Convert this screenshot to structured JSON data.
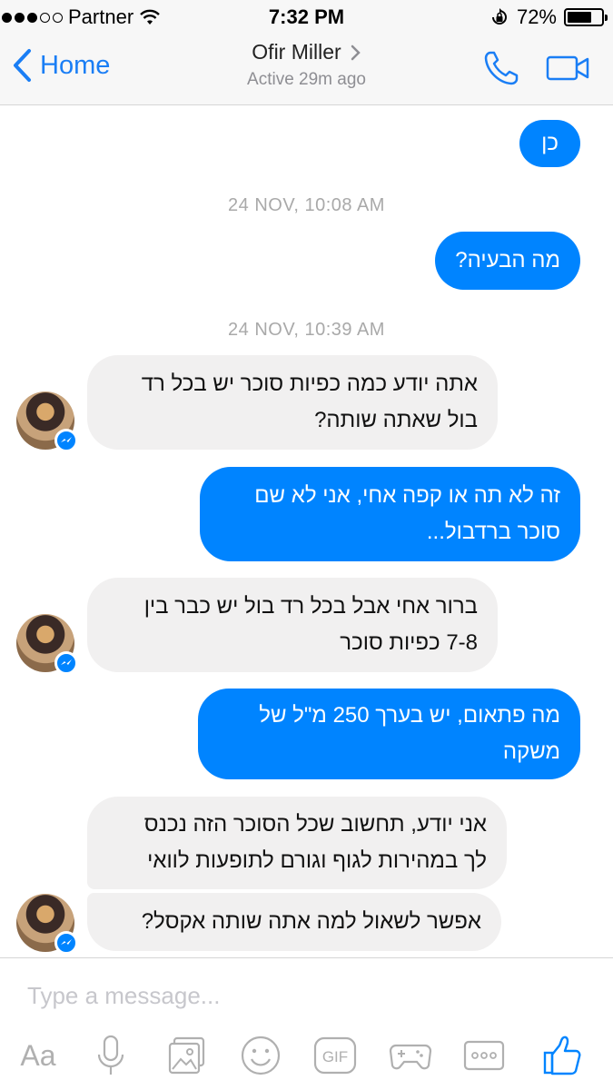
{
  "status_bar": {
    "carrier": "Partner",
    "time": "7:32 PM",
    "battery": "72%",
    "battery_level": 0.72
  },
  "header": {
    "back_label": "Home",
    "contact_name": "Ofir Miller",
    "contact_status": "Active 29m ago"
  },
  "messages": {
    "m1": "כן",
    "ts1": "24 NOV, 10:08 AM",
    "m2": "מה הבעיה?",
    "ts2": "24 NOV, 10:39 AM",
    "m3_l1": "אתה יודע כמה כפיות סוכר יש בכל רד",
    "m3_l2": "בול שאתה שותה?",
    "m4_l1": "זה לא תה או קפה אחי, אני לא שם",
    "m4_l2": "סוכר ברדבול...",
    "m5_l1": "ברור אחי אבל בכל רד בול יש כבר בין",
    "m5_l2": "7-8 כפיות סוכר",
    "m6_l1": "מה פתאום, יש בערך 250 מ\"ל של",
    "m6_l2": "משקה",
    "m7_l1": "אני יודע, תחשוב שכל הסוכר הזה נכנס",
    "m7_l2": "לך במהירות לגוף וגורם לתופעות לוואי",
    "m8": "אפשר לשאול למה אתה שותה אקסל?"
  },
  "composer": {
    "placeholder": "Type a message...",
    "aa_label": "Aa",
    "gif_label": "GIF"
  },
  "colors": {
    "accent": "#0084ff",
    "ios_blue": "#1a7ef5",
    "incoming_bubble": "#f1f0f0",
    "timestamp": "#a9a9a9"
  },
  "icons": [
    "wifi-icon",
    "rotation-lock-icon",
    "battery-icon",
    "back-chevron-icon",
    "chevron-right-icon",
    "phone-icon",
    "video-camera-icon",
    "messenger-badge-icon",
    "microphone-icon",
    "gallery-icon",
    "emoji-icon",
    "gif-icon",
    "game-controller-icon",
    "more-icon",
    "like-icon"
  ]
}
